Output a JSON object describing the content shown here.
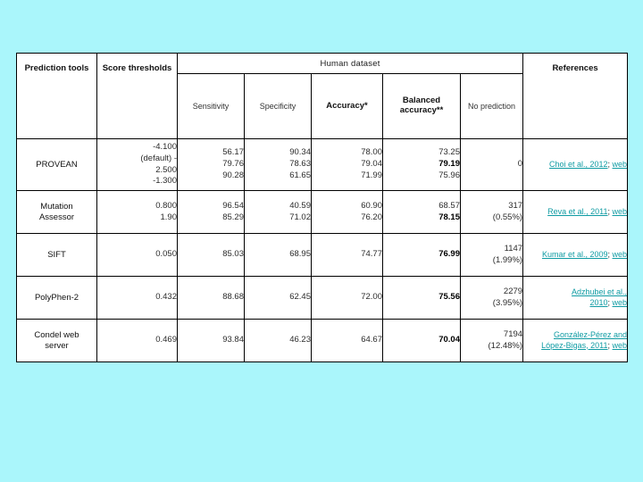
{
  "table": {
    "group_header": "Human dataset",
    "columns": [
      {
        "key": "tool",
        "label": "Prediction\ntools"
      },
      {
        "key": "thresholds",
        "label": "Score\nthresholds"
      },
      {
        "key": "sensitivity",
        "label": "Sensitivity"
      },
      {
        "key": "specificity",
        "label": "Specificity"
      },
      {
        "key": "accuracy",
        "label": "Accuracy*"
      },
      {
        "key": "balanced_accuracy",
        "label": "Balanced\naccuracy**"
      },
      {
        "key": "no_prediction",
        "label": "No\nprediction"
      },
      {
        "key": "references",
        "label": "References"
      }
    ],
    "rows": [
      {
        "tool": "PROVEAN",
        "thresholds": "-4.100\n(default) -\n2.500\n-1.300",
        "sensitivity": "56.17\n79.76\n90.28",
        "specificity": "90.34\n78.63\n61.65",
        "accuracy": "78.00\n79.04\n71.99",
        "balanced_accuracy_lines": [
          "73.25",
          "79.19",
          "75.96"
        ],
        "balanced_accuracy_bold_index": 1,
        "no_prediction": "0",
        "reference_text": "Choi et al., 2012",
        "reference_sep": "; ",
        "reference_web": "web"
      },
      {
        "tool": "Mutation\nAssessor",
        "thresholds": "0.800\n1.90",
        "sensitivity": "96.54\n85.29",
        "specificity": "40.59\n71.02",
        "accuracy": "60.90\n76.20",
        "balanced_accuracy_lines": [
          "68.57",
          "78.15"
        ],
        "balanced_accuracy_bold_index": 1,
        "no_prediction": "317\n(0.55%)",
        "reference_text": "Reva et al., 2011",
        "reference_sep": "; ",
        "reference_web": "web"
      },
      {
        "tool": "SIFT",
        "thresholds": "0.050",
        "sensitivity": "85.03",
        "specificity": "68.95",
        "accuracy": "74.77",
        "balanced_accuracy_lines": [
          "76.99"
        ],
        "balanced_accuracy_bold_index": 0,
        "no_prediction": "1147\n(1.99%)",
        "reference_text": "Kumar et al., 2009",
        "reference_sep": "; ",
        "reference_web": "web"
      },
      {
        "tool": "PolyPhen-2",
        "thresholds": "0.432",
        "sensitivity": "88.68",
        "specificity": "62.45",
        "accuracy": "72.00",
        "balanced_accuracy_lines": [
          "75.56"
        ],
        "balanced_accuracy_bold_index": 0,
        "no_prediction": "2279\n(3.95%)",
        "reference_text": "Adzhubei et al.,\n2010",
        "reference_sep": "; ",
        "reference_web": "web"
      },
      {
        "tool": "Condel web\nserver",
        "thresholds": "0.469",
        "sensitivity": "93.84",
        "specificity": "46.23",
        "accuracy": "64.67",
        "balanced_accuracy_lines": [
          "70.04"
        ],
        "balanced_accuracy_bold_index": 0,
        "no_prediction": "7194\n(12.48%)",
        "reference_text": "González-Pérez and\nLópez-Bigas, 2011",
        "reference_sep": "; ",
        "reference_web": "web"
      }
    ]
  },
  "colors": {
    "background": "#aaf6fb",
    "link": "#0f9ba3",
    "border": "#000000",
    "cell_background": "#ffffff"
  }
}
